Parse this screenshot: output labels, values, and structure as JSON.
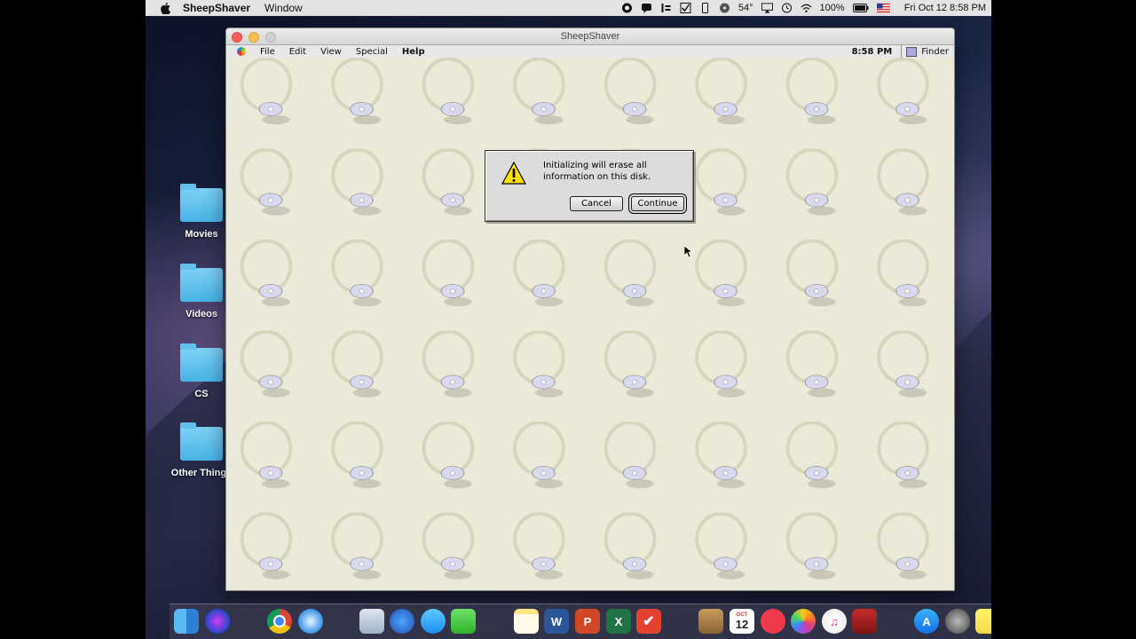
{
  "menubar": {
    "app_name": "SheepShaver",
    "menu_window": "Window",
    "temperature": "54°",
    "battery": "100%",
    "datetime": "Fri Oct 12  8:58 PM"
  },
  "desktop_folders": [
    {
      "label": "Movies"
    },
    {
      "label": "Videos"
    },
    {
      "label": "CS"
    },
    {
      "label": "Other Things"
    }
  ],
  "window": {
    "title": "SheepShaver",
    "classic_menu": {
      "file": "File",
      "edit": "Edit",
      "view": "View",
      "special": "Special",
      "help": "Help",
      "clock": "8:58 PM",
      "app_switcher": "Finder"
    }
  },
  "dialog": {
    "message_line1": "Initializing will erase all",
    "message_line2": "information on this disk.",
    "cancel_label": "Cancel",
    "continue_label": "Continue"
  },
  "dock": {
    "items": [
      "finder-icon",
      "siri-icon",
      "chrome-icon",
      "safari-icon",
      "preview-icon",
      "people-icon",
      "messages-icon",
      "facetime-icon",
      "notes-icon",
      "word-icon",
      "powerpoint-icon",
      "excel-icon",
      "todoist-icon",
      "archive-icon",
      "calendar-icon",
      "news-icon",
      "photos-icon",
      "itunes-icon",
      "photobooth-icon",
      "appstore-icon",
      "system-preferences-icon",
      "stickies-icon"
    ],
    "calendar_month": "OCT",
    "calendar_day": "12",
    "word_letter": "W",
    "powerpoint_letter": "P",
    "excel_letter": "X"
  },
  "colors": {
    "folder_blue": "#47b3e6",
    "classic_background": "#ebe9d7",
    "dialog_gray": "#dcdcdc",
    "warning_yellow": "#ffe000"
  }
}
